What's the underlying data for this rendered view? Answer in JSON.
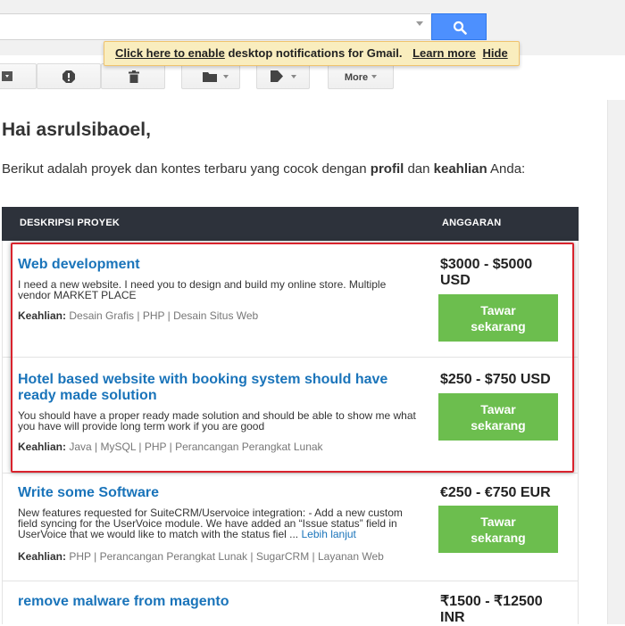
{
  "search": {
    "placeholder": ""
  },
  "notification": {
    "link_text": "Click here to enable",
    "message": " desktop notifications for Gmail.",
    "learn_more": "Learn more",
    "hide": "Hide"
  },
  "toolbar": {
    "more_label": "More"
  },
  "email": {
    "greeting": "Hai asrulsibaoel,",
    "intro_before": "Berikut adalah proyek dan kontes terbaru yang cocok dengan ",
    "intro_profile": "profil",
    "intro_mid": " dan ",
    "intro_skills": "keahlian",
    "intro_after": " Anda:",
    "table_headers": {
      "description": "DESKRIPSI PROYEK",
      "budget": "ANGGARAN"
    },
    "skills_label": "Keahlian:",
    "bid_label": "Tawar sekarang",
    "projects": [
      {
        "title": "Web development",
        "description": "I need a new website. I need you to design and build my online store. Multiple vendor MARKET PLACE",
        "skills": "Desain Grafis | PHP | Desain Situs Web",
        "budget": "$3000 - $5000 USD"
      },
      {
        "title": "Hotel based website with booking system should have ready made solution",
        "description": "You should have a proper ready made solution and should be able to show me what you have will provide long term work if you are good",
        "skills": "Java | MySQL | PHP | Perancangan Perangkat Lunak",
        "budget": "$250 - $750 USD"
      },
      {
        "title": "Write some Software",
        "description": "New features requested for SuiteCRM/Uservoice integration: - Add a new custom field syncing for the UserVoice module. We have added an “Issue status” field in UserVoice that we would like to match with the status fiel ...",
        "more_link": "Lebih lanjut",
        "skills": "PHP | Perancangan Perangkat Lunak | SugarCRM | Layanan Web",
        "budget": "€250 - €750 EUR"
      },
      {
        "title": "remove malware from magento",
        "budget": "₹1500 - ₹12500 INR"
      }
    ]
  }
}
